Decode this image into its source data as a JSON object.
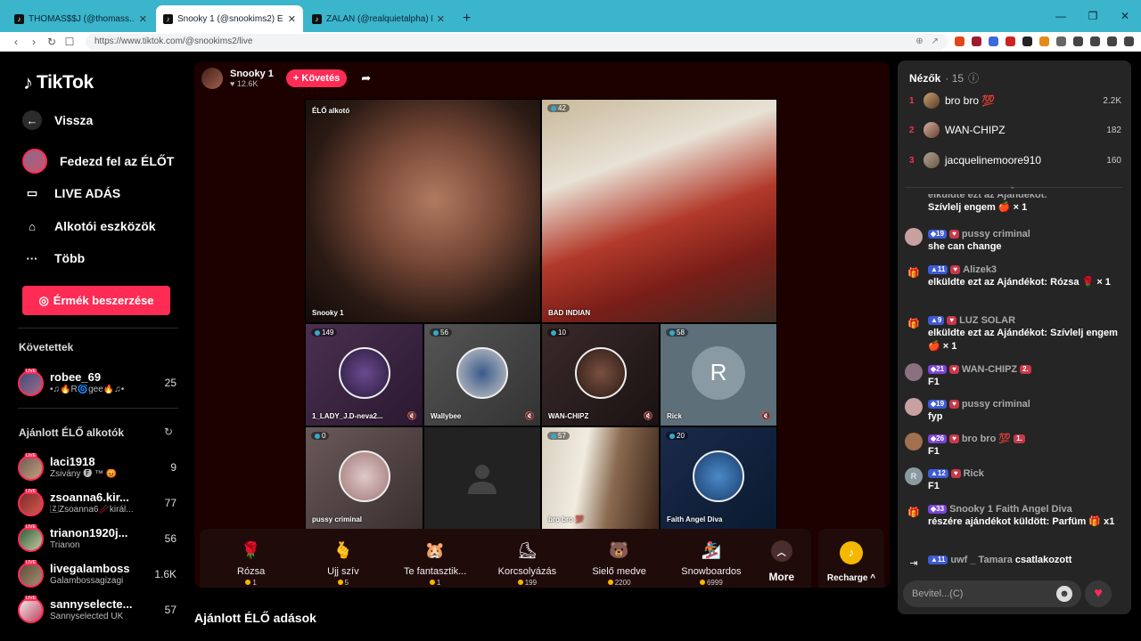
{
  "browser": {
    "tabs": [
      {
        "title": "THOMAS$$J (@thomass...",
        "fav": "♪"
      },
      {
        "title": "Snooky 1 (@snookims2) ÉLŐ",
        "fav": "♪"
      },
      {
        "title": "ZALÁN (@realquietalpha) ÉLŐ",
        "fav": "♪"
      }
    ],
    "new_tab": "+",
    "url": "https://www.tiktok.com/@snookims2/live"
  },
  "nav": {
    "logo": "TikTok",
    "back": "Vissza",
    "explore": "Fedezd fel az ÉLŐT",
    "live": "LIVE ADÁS",
    "creator_tools": "Alkotói eszközök",
    "more": "Több",
    "coins": "Érmék beszerzése",
    "following_title": "Követettek",
    "following": [
      {
        "name": "robee_69",
        "sub": "•♫🔥R🌀gee🔥♫•",
        "count": "25"
      }
    ],
    "recommended_title": "Ajánlott ÉLŐ alkotók",
    "recommended": [
      {
        "name": "laci1918",
        "sub": "Zsivány 🅕 ™ 😡",
        "count": "9"
      },
      {
        "name": "zsoanna6.kir...",
        "sub": "🅉Zsoanna6🥢királ...",
        "count": "77"
      },
      {
        "name": "trianon1920j...",
        "sub": "Trianon",
        "count": "56"
      },
      {
        "name": "livegalamboss",
        "sub": "Galambossagizagi",
        "count": "1.6K"
      },
      {
        "name": "sannyselecte...",
        "sub": "Sannyselected UK",
        "count": "57"
      }
    ],
    "live_badge": "LIVE"
  },
  "stream": {
    "host_name": "Snooky 1",
    "host_likes": "12.6K",
    "follow": "+ Követés",
    "top_left_label": "ÉLŐ alkotó",
    "main_name": "Snooky 1",
    "guest2": {
      "count": "42",
      "name": "BAD INDIAN"
    },
    "guests": [
      {
        "count": "149",
        "name": "1_LADY_J.D-neva2..."
      },
      {
        "count": "56",
        "name": "Wallybee"
      },
      {
        "count": "10",
        "name": "WAN-CHIPZ"
      },
      {
        "count": "58",
        "name": "Rick",
        "initial": "R"
      },
      {
        "count": "0",
        "name": "pussy criminal"
      },
      {
        "count": "",
        "name": ""
      },
      {
        "count": "57",
        "name": "bro bro 💯"
      },
      {
        "count": "20",
        "name": "Faith Angel Diva"
      }
    ]
  },
  "gifts": [
    {
      "name": "Rózsa",
      "price": "1",
      "icon": "🌹"
    },
    {
      "name": "Ujj szív",
      "price": "5",
      "icon": "🫰"
    },
    {
      "name": "Te fantasztik...",
      "price": "1",
      "icon": "🐹"
    },
    {
      "name": "Korcsolyázás",
      "price": "199",
      "icon": "⛸"
    },
    {
      "name": "Sielő medve",
      "price": "2200",
      "icon": "🐻"
    },
    {
      "name": "Snowboardos",
      "price": "6999",
      "icon": "🏂"
    }
  ],
  "gift_more": "More",
  "recharge": "Recharge",
  "recommended_live": "Ajánlott ÉLŐ adások",
  "viewers": {
    "title": "Nézők",
    "count": "15",
    "list": [
      {
        "rank": "1",
        "name": "bro bro 💯",
        "score": "2.2K"
      },
      {
        "rank": "2",
        "name": "WAN-CHIPZ",
        "score": "182"
      },
      {
        "rank": "3",
        "name": "jacquelinemoore910",
        "score": "160"
      }
    ]
  },
  "chat": [
    {
      "head": "elküldte ezt az Ajándékot:",
      "text": "Szívlelj engem 🍎 × 1",
      "level": "",
      "fan": ""
    },
    {
      "head": "pussy criminal",
      "text": "she can change",
      "level": "19",
      "fan": "",
      "icon": ""
    },
    {
      "head": "Alizek3",
      "text": "elküldte ezt az Ajándékot: Rózsa 🌹 × 1",
      "level": "11",
      "fan": "",
      "icon": "gift"
    },
    {
      "head": "LUZ SOLAR",
      "text": "elküldte ezt az Ajándékot: Szívlelj engem 🍎 × 1",
      "level": "9",
      "fan": "",
      "icon": "gift"
    },
    {
      "head": "WAN-CHIPZ",
      "text": "F1",
      "level": "21",
      "fan": "2.",
      "icon": ""
    },
    {
      "head": "pussy criminal",
      "text": "fyp",
      "level": "19",
      "fan": "",
      "icon": ""
    },
    {
      "head": "bro bro 💯",
      "text": "F1",
      "level": "26",
      "fan": "1.",
      "icon": ""
    },
    {
      "head": "Rick",
      "text": "F1",
      "level": "12",
      "fan": "",
      "icon": "R"
    },
    {
      "head": "Snooky 1 Faith Angel Diva",
      "text": "részére ajándékot küldött: Parfüm 🎁 x1",
      "level": "33",
      "fan": "",
      "icon": "gift"
    },
    {
      "head": "uwf _ Tamara",
      "text": "csatlakozott",
      "level": "11",
      "fan": "",
      "icon": "join"
    }
  ],
  "chat_input": {
    "placeholder": "Bevitel...(C)"
  },
  "colors": {
    "accent": "#fe2c55",
    "tab_strip": "#3ab5cc",
    "panel": "#252525"
  }
}
